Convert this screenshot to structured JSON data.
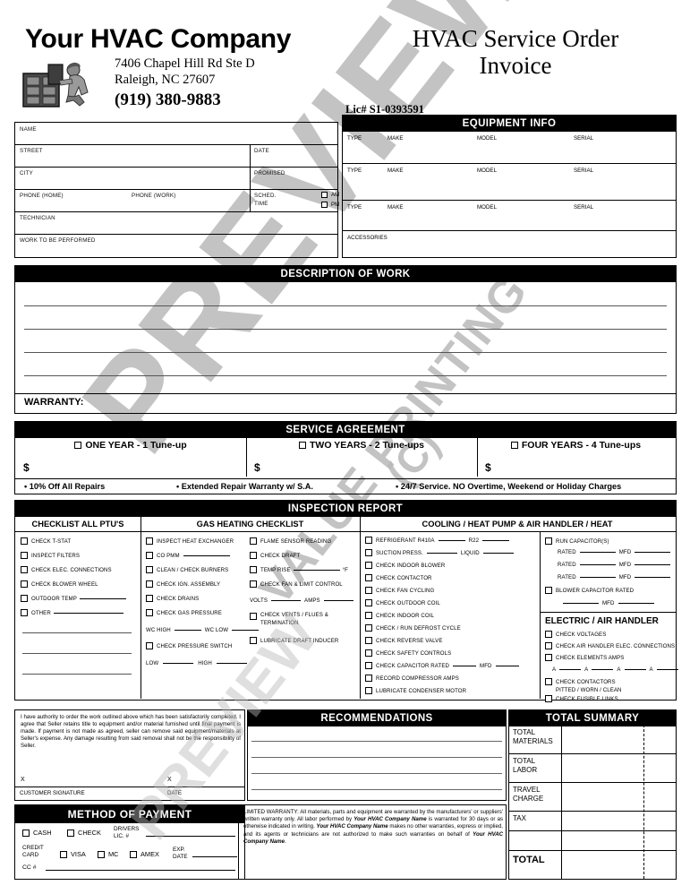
{
  "document": {
    "title_line1": "HVAC Service Order",
    "title_line2": "Invoice",
    "company_name": "Your HVAC Company",
    "address_line1": "7406 Chapel Hill Rd Ste D",
    "address_line2": "Raleigh, NC 27607",
    "phone": "(919) 380-9883",
    "license": "Lic#  S1-0393591",
    "logo_alt": "hvac-technician-logo"
  },
  "watermark": {
    "word1": "PREVIEW",
    "word2": "VALUE PRINTING",
    "word3": "(C)",
    "word4": "PREVIEW"
  },
  "customer_info": {
    "name": "NAME",
    "street": "STREET",
    "city": "CITY",
    "phone_home": "PHONE (HOME)",
    "phone_work": "PHONE (WORK)",
    "technician": "TECHNICIAN",
    "work_to_be_performed": "WORK TO BE PERFORMED",
    "date": "DATE",
    "promised": "PROMISED",
    "sched": "SCHED.",
    "time": "TIME",
    "am": "AM",
    "pm": "PM"
  },
  "equipment_info": {
    "heading": "EQUIPMENT INFO",
    "columns": [
      "TYPE",
      "MAKE",
      "MODEL",
      "SERIAL"
    ],
    "rows": 3,
    "accessories": "ACCESSORIES"
  },
  "description_of_work": {
    "heading": "DESCRIPTION OF WORK",
    "warranty_label": "WARRANTY:"
  },
  "service_agreement": {
    "heading": "SERVICE AGREEMENT",
    "options": [
      {
        "label": "ONE YEAR - 1 Tune-up",
        "amount_symbol": "$"
      },
      {
        "label": "TWO YEARS - 2 Tune-ups",
        "amount_symbol": "$"
      },
      {
        "label": "FOUR YEARS - 4 Tune-ups",
        "amount_symbol": "$"
      }
    ],
    "benefits": [
      "• 10% Off All Repairs",
      "• Extended Repair Warranty w/ S.A.",
      "• 24/7 Service. NO Overtime, Weekend or Holiday Charges"
    ]
  },
  "inspection_report": {
    "heading": "INSPECTION REPORT",
    "col1_heading": "CHECKLIST ALL PTU'S",
    "col2_heading": "GAS HEATING CHECKLIST",
    "col3_heading": "COOLING / HEAT PUMP & AIR HANDLER / HEAT",
    "ptu_items": [
      "CHECK T-STAT",
      "INSPECT FILTERS",
      "CHECK ELEC. CONNECTIONS",
      "CHECK BLOWER WHEEL",
      "OUTDOOR TEMP",
      "OTHER"
    ],
    "gas_col_a": [
      "INSPECT HEAT EXCHANGER",
      "CO PMM",
      "CLEAN / CHECK BURNERS",
      "CHECK IGN. ASSEMBLY",
      "CHECK DRAINS",
      "CHECK GAS PRESSURE"
    ],
    "gas_col_a_extra": {
      "wc_high": "WC HIGH",
      "wc_low": "WC LOW",
      "pressure_switch": "CHECK PRESSURE SWITCH",
      "low": "LOW",
      "high": "HIGH"
    },
    "gas_col_b": [
      "FLAME SENSOR READING",
      "CHECK DRAFT",
      "TEMP RISE",
      "CHECK FAN & LIMIT CONTROL"
    ],
    "gas_col_b_extra": {
      "degree": "°F",
      "volts": "VOLTS",
      "amps": "AMPS",
      "vents_line1": "CHECK VENTS / FLUES &",
      "vents_line2": "TERMINATION",
      "lubricate": "LUBRICATE DRAFT INDUCER"
    },
    "cooling_items": [
      "REFRIGERANT R410A",
      "SUCTION PRESS.",
      "CHECK INDOOR BLOWER",
      "CHECK CONTACTOR",
      "CHECK FAN CYCLING",
      "CHECK OUTDOOR COIL",
      "CHECK INDOOR COIL",
      "CHECK / RUN DEFROST CYCLE",
      "CHECK REVERSE VALVE",
      "CHECK SAFETY CONTROLS",
      "CHECK CAPACITOR  RATED",
      "RECORD COMPRESSOR AMPS",
      "LUBRICATE CONDENSER MOTOR"
    ],
    "cooling_inline": {
      "r22": "R22",
      "liquid": "LIQUID",
      "mfd": "MFD"
    },
    "capacitors": {
      "run_capacitors": "RUN CAPACITOR(S)",
      "rated": "RATED",
      "mfd": "MFD",
      "rated_rows": 3,
      "blower_capacitor": "BLOWER CAPACITOR RATED"
    },
    "electric_heading": "ELECTRIC / AIR HANDLER",
    "electric_items": [
      "CHECK VOLTAGES",
      "CHECK AIR HANDLER ELEC. CONNECTIONS",
      "CHECK ELEMENTS AMPS"
    ],
    "electric_extra": {
      "amps_row": "A",
      "check_contactors": "CHECK CONTACTORS",
      "condition": "PITTED   /    WORN   /    CLEAN",
      "fusible_links": "CHECK FUSIBLE LINKS"
    }
  },
  "authority": {
    "text": "I have authority to order the work outlined above which has been satisfactorily completed.   I agree that Seller retains title to equipment and/or material furnished until final payment is made. If payment is not made as agreed, seller can remove said equipment/materials at Seller's expense.  Any damage resulting from said removal shall not be the responsibility of Seller.",
    "x_mark": "X",
    "customer_signature": "CUSTOMER SIGNATURE",
    "date": "DATE"
  },
  "method_of_payment": {
    "heading": "METHOD OF PAYMENT",
    "cash": "CASH",
    "check": "CHECK",
    "drivers_lic_line1": "DRIVERS",
    "drivers_lic_line2": "LIC. #",
    "credit_card_line1": "CREDIT",
    "credit_card_line2": "CARD",
    "visa": "VISA",
    "mc": "MC",
    "amex": "AMEX",
    "exp_line1": "EXP.",
    "exp_line2": "DATE",
    "cc_number": "CC #"
  },
  "recommendations": {
    "heading": "RECOMMENDATIONS"
  },
  "limited_warranty": {
    "prefix": "LIMITED WARRANTY:  All materials, parts and equipment are warranted by the manufacturers' or suppliers' written warranty only. All labor performed by ",
    "company1": "Your HVAC Company Name",
    "mid1": " is warranted for 30 days or as otherwise indicated in writing. ",
    "company2": "Your HVAC Company Name",
    "mid2": " makes no other warranties, express or implied, and its agents or technicians are not authorized to make such warranties on behalf of ",
    "company3": "Your HVAC Company Name",
    "suffix": "."
  },
  "total_summary": {
    "heading": "TOTAL SUMMARY",
    "rows": [
      {
        "line1": "TOTAL",
        "line2": "MATERIALS"
      },
      {
        "line1": "TOTAL",
        "line2": "LABOR"
      },
      {
        "line1": "TRAVEL",
        "line2": "CHARGE"
      },
      {
        "line1": "TAX",
        "line2": ""
      },
      {
        "line1": "",
        "line2": ""
      }
    ],
    "total_label": "TOTAL"
  },
  "colors": {
    "bar_bg": "#000000",
    "bar_text": "#ffffff",
    "watermark": "#b9b9b9",
    "page_bg": "#ffffff"
  }
}
